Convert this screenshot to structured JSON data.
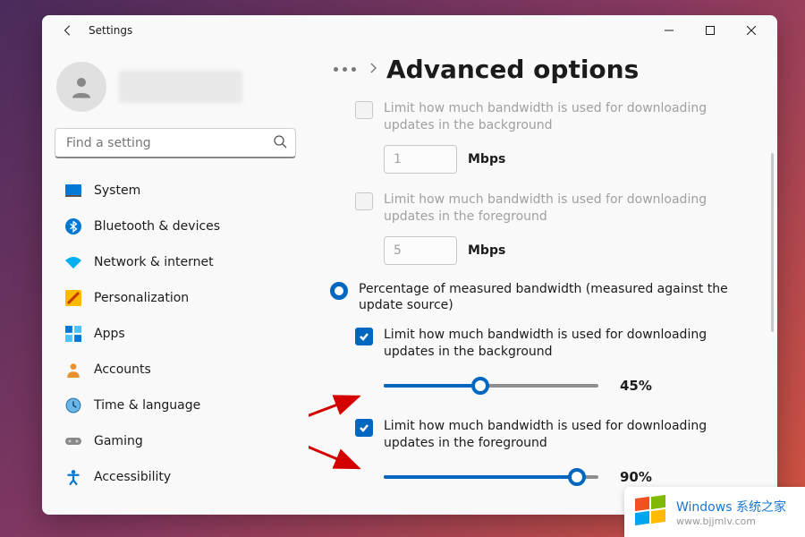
{
  "app_title": "Settings",
  "search": {
    "placeholder": "Find a setting"
  },
  "nav": [
    {
      "label": "System",
      "icon": "system"
    },
    {
      "label": "Bluetooth & devices",
      "icon": "bluetooth"
    },
    {
      "label": "Network & internet",
      "icon": "network"
    },
    {
      "label": "Personalization",
      "icon": "personalization"
    },
    {
      "label": "Apps",
      "icon": "apps"
    },
    {
      "label": "Accounts",
      "icon": "accounts"
    },
    {
      "label": "Time & language",
      "icon": "time"
    },
    {
      "label": "Gaming",
      "icon": "gaming"
    },
    {
      "label": "Accessibility",
      "icon": "accessibility"
    }
  ],
  "page_title": "Advanced options",
  "absolute": {
    "bg_label": "Limit how much bandwidth is used for downloading updates in the background",
    "bg_value": "1",
    "fg_label": "Limit how much bandwidth is used for downloading updates in the foreground",
    "fg_value": "5",
    "unit": "Mbps"
  },
  "percentage": {
    "radio_label": "Percentage of measured bandwidth (measured against the update source)",
    "bg_label": "Limit how much bandwidth is used for downloading updates in the background",
    "bg_value": 45,
    "bg_display": "45%",
    "fg_label": "Limit how much bandwidth is used for downloading updates in the foreground",
    "fg_value": 90,
    "fg_display": "90%"
  },
  "watermark": {
    "line1": "Windows 系统之家",
    "line2": "www.bjjmlv.com"
  }
}
